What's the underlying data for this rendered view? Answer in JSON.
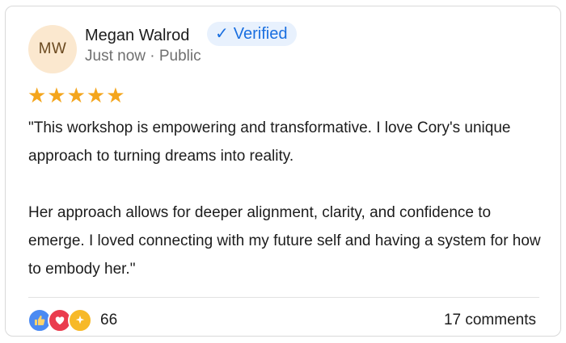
{
  "author": {
    "initials": "MW",
    "name": "Megan Walrod",
    "verified_label": "Verified",
    "meta": "Just now · Public"
  },
  "rating": {
    "stars": 5,
    "stars_text": "★★★★★"
  },
  "review": {
    "paragraph_1": "\"This workshop is empowering and transformative. I love Cory's unique approach to turning dreams into reality.",
    "paragraph_2": "Her approach allows for deeper alignment, clarity, and confidence to emerge. I loved connecting with my future self and having a system for how to embody her.\""
  },
  "footer": {
    "reaction_count": "66",
    "comments_label": "17 comments",
    "reaction_icons": [
      "thumbs-up-icon",
      "heart-icon",
      "sparkle-icon"
    ]
  },
  "colors": {
    "verified": "#1a6fe0",
    "stars": "#f4a51c",
    "avatar_bg": "#fbe8cf"
  }
}
